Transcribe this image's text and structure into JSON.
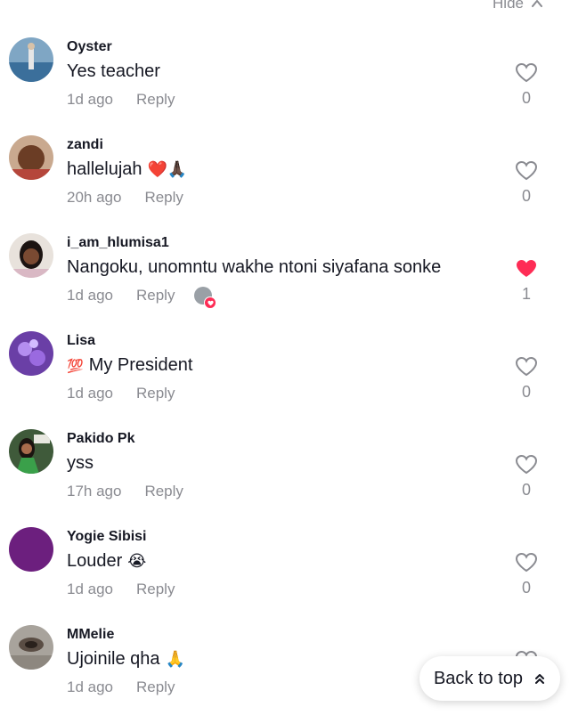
{
  "hide_label": "Hide",
  "back_to_top_label": "Back to top",
  "comments": [
    {
      "username": "Oyster",
      "text": "Yes teacher",
      "time": "1d ago",
      "reply": "Reply",
      "likes": "0",
      "liked": false
    },
    {
      "username": "zandi",
      "text": "hallelujah",
      "emoji": "❤️🙏🏿",
      "time": "20h ago",
      "reply": "Reply",
      "likes": "0",
      "liked": false
    },
    {
      "username": "i_am_hlumisa1",
      "text": "Nangoku, unomntu wakhe ntoni siyafana sonke",
      "time": "1d ago",
      "reply": "Reply",
      "likes": "1",
      "liked": true
    },
    {
      "username": "Lisa",
      "emoji_prefix": "💯",
      "text": "My President",
      "time": "1d ago",
      "reply": "Reply",
      "likes": "0",
      "liked": false
    },
    {
      "username": "Pakido Pk",
      "text": "yss",
      "time": "17h ago",
      "reply": "Reply",
      "likes": "0",
      "liked": false
    },
    {
      "username": "Yogie Sibisi",
      "text": "Louder",
      "emoji": "😭",
      "time": "1d ago",
      "reply": "Reply",
      "likes": "0",
      "liked": false
    },
    {
      "username": "MMelie",
      "text": "Ujoinile qha",
      "emoji": "🙏",
      "time": "1d ago",
      "reply": "Reply",
      "likes": "",
      "liked": false
    }
  ],
  "colors": {
    "liked_heart": "#fe2c55",
    "muted_text": "#8a8b91",
    "primary_text": "#161823"
  }
}
